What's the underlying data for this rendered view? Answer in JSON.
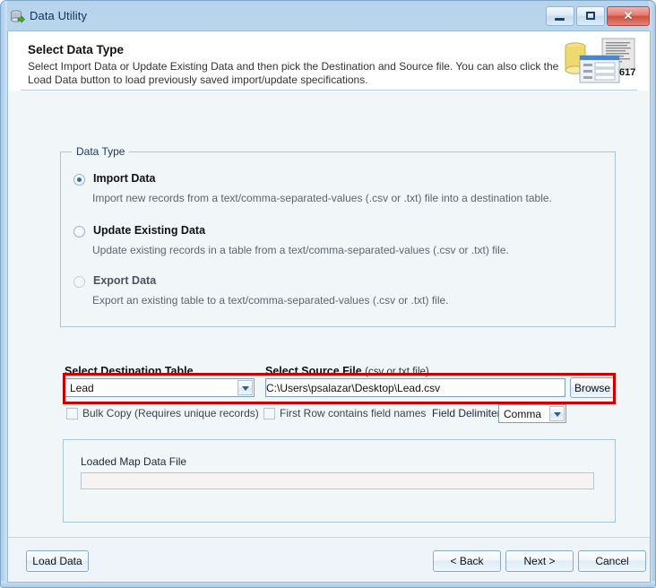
{
  "window": {
    "title": "Data Utility",
    "icon": "database-arrow-icon",
    "controls": {
      "minimize": "minimize-icon",
      "maximize": "maximize-icon",
      "close": "close-icon",
      "close_glyph": "✕"
    }
  },
  "header": {
    "title": "Select Data Type",
    "description": "Select Import Data or Update Existing Data and then pick the Destination and Source file.  You can also click the Load Data button to load previously saved import/update specifications.",
    "icon": "database-documents-icon",
    "icon_badge": "617"
  },
  "data_type": {
    "legend": "Data Type",
    "options": [
      {
        "label": "Import Data",
        "description": "Import new records from a text/comma-separated-values (.csv or .txt) file into a destination table.",
        "selected": true,
        "enabled": true
      },
      {
        "label": "Update Existing Data",
        "description": "Update existing records in a table from a text/comma-separated-values (.csv or .txt) file.",
        "selected": false,
        "enabled": true
      },
      {
        "label": "Export Data",
        "description": "Export an existing table to a text/comma-separated-values (.csv or .txt) file.",
        "selected": false,
        "enabled": false
      }
    ]
  },
  "selection": {
    "destination_label": "Select Destination Table",
    "destination_value": "Lead",
    "source_label": "Select Source File",
    "source_label_hint": "(csv or txt file)",
    "source_value": "C:\\Users\\psalazar\\Desktop\\Lead.csv",
    "browse_label": "Browse",
    "highlight_color": "#cc0000"
  },
  "options_row": {
    "bulk_copy_label": "Bulk Copy (Requires unique records)",
    "bulk_copy_checked": false,
    "first_row_label": "First Row contains field names",
    "first_row_checked": false,
    "delimiter_label": "Field Delimiter",
    "delimiter_value": "Comma"
  },
  "map_panel": {
    "label": "Loaded Map Data File",
    "value": ""
  },
  "footer": {
    "load_data": "Load Data",
    "back": "< Back",
    "next": "Next >",
    "cancel": "Cancel"
  }
}
